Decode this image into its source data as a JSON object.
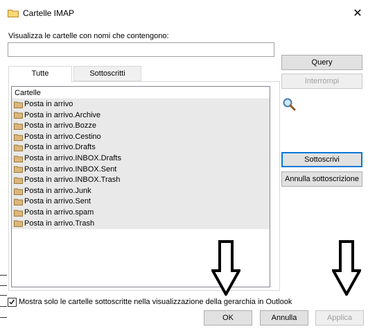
{
  "window": {
    "title": "Cartelle IMAP",
    "close_glyph": "✕"
  },
  "filter": {
    "label": "Visualizza le cartelle con nomi che contengono:",
    "value": ""
  },
  "tabs": {
    "all": "Tutte",
    "subscribed": "Sottoscritti"
  },
  "list": {
    "header": "Cartelle",
    "items": [
      "Posta in arrivo",
      "Posta in arrivo.Archive",
      "Posta in arrivo.Bozze",
      "Posta in arrivo.Cestino",
      "Posta in arrivo.Drafts",
      "Posta in arrivo.INBOX.Drafts",
      "Posta in arrivo.INBOX.Sent",
      "Posta in arrivo.INBOX.Trash",
      "Posta in arrivo.Junk",
      "Posta in arrivo.Sent",
      "Posta in arrivo.spam",
      "Posta in arrivo.Trash"
    ],
    "item_icon": "folder-icon"
  },
  "side_buttons": {
    "query": "Query",
    "stop": "Interrompi",
    "subscribe": "Sottoscrivi",
    "unsubscribe": "Annulla sottoscrizione"
  },
  "checkbox": {
    "label": "Mostra solo le cartelle sottoscritte nella visualizzazione della gerarchia in Outlook",
    "checked": true
  },
  "footer": {
    "ok": "OK",
    "cancel": "Annulla",
    "apply": "Applica"
  },
  "colors": {
    "accent": "#0078d7",
    "folder": "#dcb67a",
    "row_bg": "#e9e9e9"
  }
}
